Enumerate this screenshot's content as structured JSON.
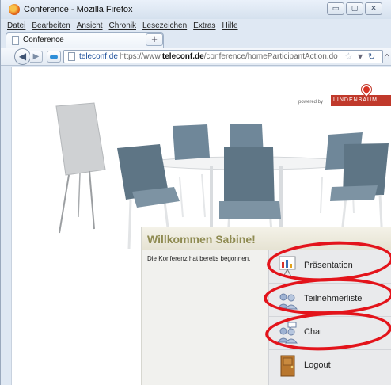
{
  "window": {
    "title": "Conference - Mozilla Firefox",
    "controls": {
      "minimize": "▭",
      "maximize": "▢",
      "close": "✕"
    }
  },
  "menubar": {
    "items": [
      "Datei",
      "Bearbeiten",
      "Ansicht",
      "Chronik",
      "Lesezeichen",
      "Extras",
      "Hilfe"
    ]
  },
  "tabs": {
    "active_label": "Conference",
    "new_tab": "+"
  },
  "navbar": {
    "site_domain": "teleconf.de",
    "url_prefix": "https://www.",
    "url_host": "teleconf.de",
    "url_path": "/conference/homeParticipantAction.do",
    "star_icon": "star-icon",
    "reload_icon": "reload-icon",
    "home_icon": "home-icon"
  },
  "branding": {
    "powered_by": "powered by",
    "brand_name": "LINDENBAUM"
  },
  "welcome": {
    "title": "Willkommen  Sabine!",
    "status": "Die Konferenz hat bereits begonnen."
  },
  "actions": [
    {
      "label": "Präsentation",
      "icon": "presentation-icon",
      "highlighted": true
    },
    {
      "label": "Teilnehmerliste",
      "icon": "participants-icon",
      "highlighted": true
    },
    {
      "label": "Chat",
      "icon": "chat-icon",
      "highlighted": true
    },
    {
      "label": "Logout",
      "icon": "door-icon",
      "highlighted": false
    }
  ],
  "colors": {
    "highlight_ring": "#e3141b",
    "welcome_title": "#8f8b52",
    "brand": "#c0392b"
  }
}
